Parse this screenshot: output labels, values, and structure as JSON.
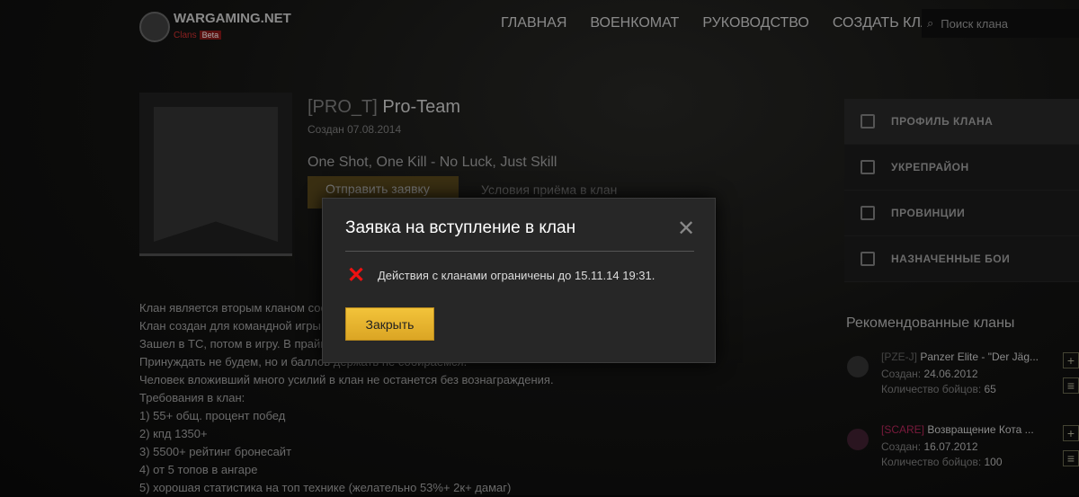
{
  "header": {
    "logo": "WARGAMING.NET",
    "logo_sub": "Clans",
    "beta": "Beta",
    "nav": [
      "ГЛАВНАЯ",
      "ВОЕНКОМАТ",
      "РУКОВОДСТВО",
      "СОЗДАТЬ КЛАН"
    ],
    "search_placeholder": "Поиск клана"
  },
  "clan": {
    "tag": "[PRO_T]",
    "name": "Pro-Team",
    "created": "Создан 07.08.2014",
    "motto": "One Shot, One Kill - No Luck, Just Skill",
    "apply": "Отправить заявку",
    "conditions": "Условия приёма в клан",
    "description": [
      "Клан является вторым кланом сообщества PRO_T. Первый клан PRO_T",
      "Клан создан для командной игры без лишних нервов.",
      "Зашел в ТС, потом в игру. В прайм-тайм желательно посещение клановых мероприятий",
      "Принуждать не будем, но и баллов держать не собираемся.",
      "Человек вложивший много усилий в клан не останется без вознаграждения.",
      "Требования в клан:",
      "1) 55+ общ. процент побед",
      "2) кпд 1350+",
      "3) 5500+ рейтинг бронесайт",
      "4) от 5 топов в ангаре",
      "5) хорошая статистика на топ технике (желательно 53%+ 2к+ дамаг)"
    ]
  },
  "sidebar": {
    "items": [
      "ПРОФИЛЬ КЛАНА",
      "УКРЕПРАЙОН",
      "ПРОВИНЦИИ",
      "НАЗНАЧЕННЫЕ БОИ"
    ]
  },
  "recommended": {
    "title": "Рекомендованные кланы",
    "created_label": "Создан:",
    "count_label": "Количество бойцов:",
    "clans": [
      {
        "tag": "[PZE-J]",
        "name": "Panzer Elite - \"Der Jäg...",
        "created": "24.06.2012",
        "count": "65",
        "color": "#ddd"
      },
      {
        "tag": "[SCARE]",
        "name": "Возвращение Кота ...",
        "created": "16.07.2012",
        "count": "100",
        "color": "#c2185b"
      }
    ]
  },
  "modal": {
    "title": "Заявка на вступление в клан",
    "message": "Действия с кланами ограничены до 15.11.14 19:31.",
    "close_button": "Закрыть"
  }
}
